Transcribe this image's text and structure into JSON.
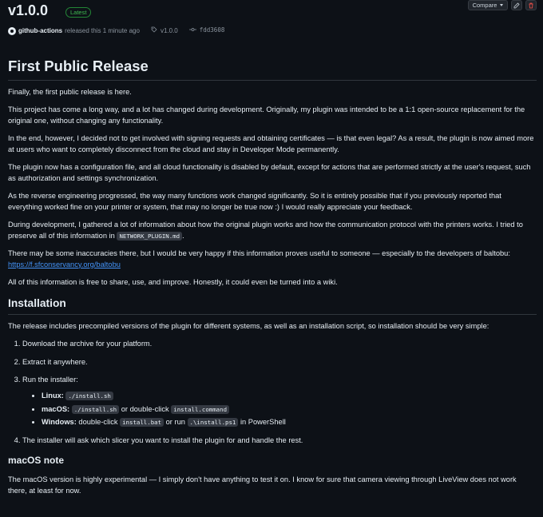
{
  "release": {
    "version": "v1.0.0",
    "badge": "Latest",
    "compare_label": "Compare",
    "author": "github-actions",
    "released_text": "released this 1 minute ago",
    "tag": "v1.0.0",
    "commit": "fdd3608"
  },
  "content": {
    "title": "First Public Release",
    "p1": "Finally, the first public release is here.",
    "p2": "This project has come a long way, and a lot has changed during development. Originally, my plugin was intended to be a 1:1 open-source replacement for the original one, without changing any functionality.",
    "p3": "In the end, however, I decided not to get involved with signing requests and obtaining certificates — is that even legal? As a result, the plugin is now aimed more at users who want to completely disconnect from the cloud and stay in Developer Mode permanently.",
    "p4": "The plugin now has a configuration file, and all cloud functionality is disabled by default, except for actions that are performed strictly at the user's request, such as authorization and settings synchronization.",
    "p5": "As the reverse engineering progressed, the way many functions work changed significantly. So it is entirely possible that if you previously reported that everything worked fine on your printer or system, that may no longer be true now :) I would really appreciate your feedback.",
    "p6_pre": "During development, I gathered a lot of information about how the original plugin works and how the communication protocol with the printers works. I tried to preserve all of this information in",
    "p6_code": "NETWORK_PLUGIN.md",
    "p6_post": ".",
    "p7_text": "There may be some inaccuracies there, but I would be very happy if this information proves useful to someone — especially to the developers of baltobu:",
    "p7_link": "https://f.sfconservancy.org/baltobu",
    "p8": "All of this information is free to share, use, and improve. Honestly, it could even be turned into a wiki.",
    "install_heading": "Installation",
    "install_intro": "The release includes precompiled versions of the plugin for different systems, as well as an installation script, so installation should be very simple:",
    "steps": {
      "s1": "Download the archive for your platform.",
      "s2": "Extract it anywhere.",
      "s3": "Run the installer:",
      "s4": "The installer will ask which slicer you want to install the plugin for and handle the rest."
    },
    "platforms": {
      "linux_label": "Linux:",
      "linux_cmd": "./install.sh",
      "mac_label": "macOS:",
      "mac_cmd": "./install.sh",
      "mac_or": "or double-click",
      "mac_cmd2": "install.command",
      "win_label": "Windows:",
      "win_pre": "double-click",
      "win_cmd": "install.bat",
      "win_or": "or run",
      "win_cmd2": ".\\install.ps1",
      "win_post": "in PowerShell"
    },
    "macos_heading": "macOS note",
    "macos_text": "The macOS version is highly experimental — I simply don't have anything to test it on. I know for sure that camera viewing through LiveView does not work there, at least for now."
  },
  "icons": {
    "github": "github-icon",
    "tag": "tag-icon",
    "commit": "commit-icon",
    "edit": "pencil-icon",
    "delete": "trash-icon"
  },
  "colors": {
    "background": "#0d1117",
    "text": "#e6edf3",
    "muted": "#8b949e",
    "link": "#4493f8",
    "latest": "#3fb950",
    "danger": "#f85149"
  }
}
